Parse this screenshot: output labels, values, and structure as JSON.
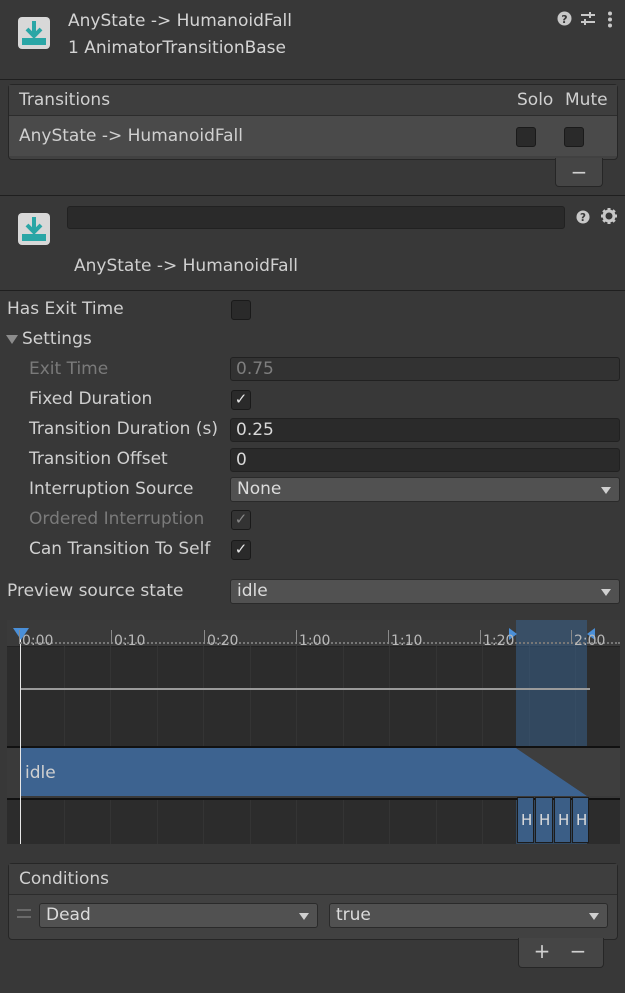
{
  "header": {
    "title": "AnyState -> HumanoidFall",
    "subtitle": "1 AnimatorTransitionBase",
    "icons": [
      "help-icon",
      "preset-icon",
      "more-icon"
    ]
  },
  "transitions": {
    "title": "Transitions",
    "col_solo": "Solo",
    "col_mute": "Mute",
    "rows": [
      {
        "name": "AnyState -> HumanoidFall",
        "solo": false,
        "mute": false
      }
    ],
    "remove_label": "−"
  },
  "transition": {
    "name_value": "",
    "name": "AnyState -> HumanoidFall"
  },
  "settings": {
    "has_exit_time_label": "Has Exit Time",
    "section_label": "Settings",
    "exit_time_label": "Exit Time",
    "exit_time_value": "0.75",
    "fixed_duration_label": "Fixed Duration",
    "transition_duration_label": "Transition Duration (s)",
    "transition_duration_value": "0.25",
    "transition_offset_label": "Transition Offset",
    "transition_offset_value": "0",
    "interruption_source_label": "Interruption Source",
    "interruption_source_value": "None",
    "ordered_interruption_label": "Ordered Interruption",
    "can_transition_label": "Can Transition To Self",
    "check_mark": "✓"
  },
  "preview": {
    "label": "Preview source state",
    "value": "idle"
  },
  "timeline": {
    "ticks": [
      "0:00",
      "0:10",
      "0:20",
      "1:00",
      "1:10",
      "1:20",
      "2:00"
    ],
    "source_clip": "idle",
    "dest_clips": [
      "H",
      "H",
      "H",
      "H"
    ]
  },
  "conditions": {
    "title": "Conditions",
    "rows": [
      {
        "parameter": "Dead",
        "value": "true"
      }
    ],
    "add_label": "+",
    "remove_label": "−"
  },
  "colors": {
    "background": "#383838",
    "panel": "#414141",
    "accent_blue": "#3a6a9e",
    "timeline_clip": "#365f8c"
  }
}
